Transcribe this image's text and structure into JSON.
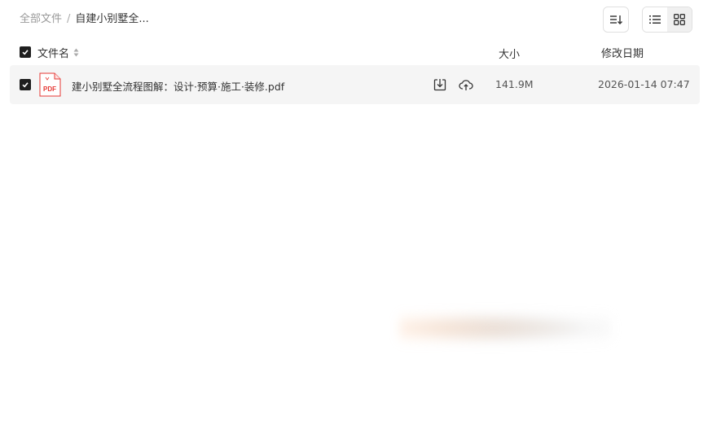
{
  "breadcrumb": {
    "root": "全部文件",
    "separator": "/",
    "current": "自建小别墅全..."
  },
  "toolbar": {
    "sort_icon": "sort-lines-icon",
    "list_view_icon": "list-view-icon",
    "grid_view_icon": "grid-view-icon"
  },
  "table": {
    "columns": {
      "name": "文件名",
      "size": "大小",
      "date": "修改日期"
    },
    "rows": [
      {
        "checked": true,
        "file_type": "PDF",
        "name": "建小别墅全流程图解：设计·预算·施工·装修.pdf",
        "size": "141.9M",
        "modified": "2026-01-14 07:47"
      }
    ]
  },
  "colors": {
    "row_bg": "#f5f5f5",
    "checkbox": "#1f1f1f",
    "pdf_red": "#e53935"
  }
}
